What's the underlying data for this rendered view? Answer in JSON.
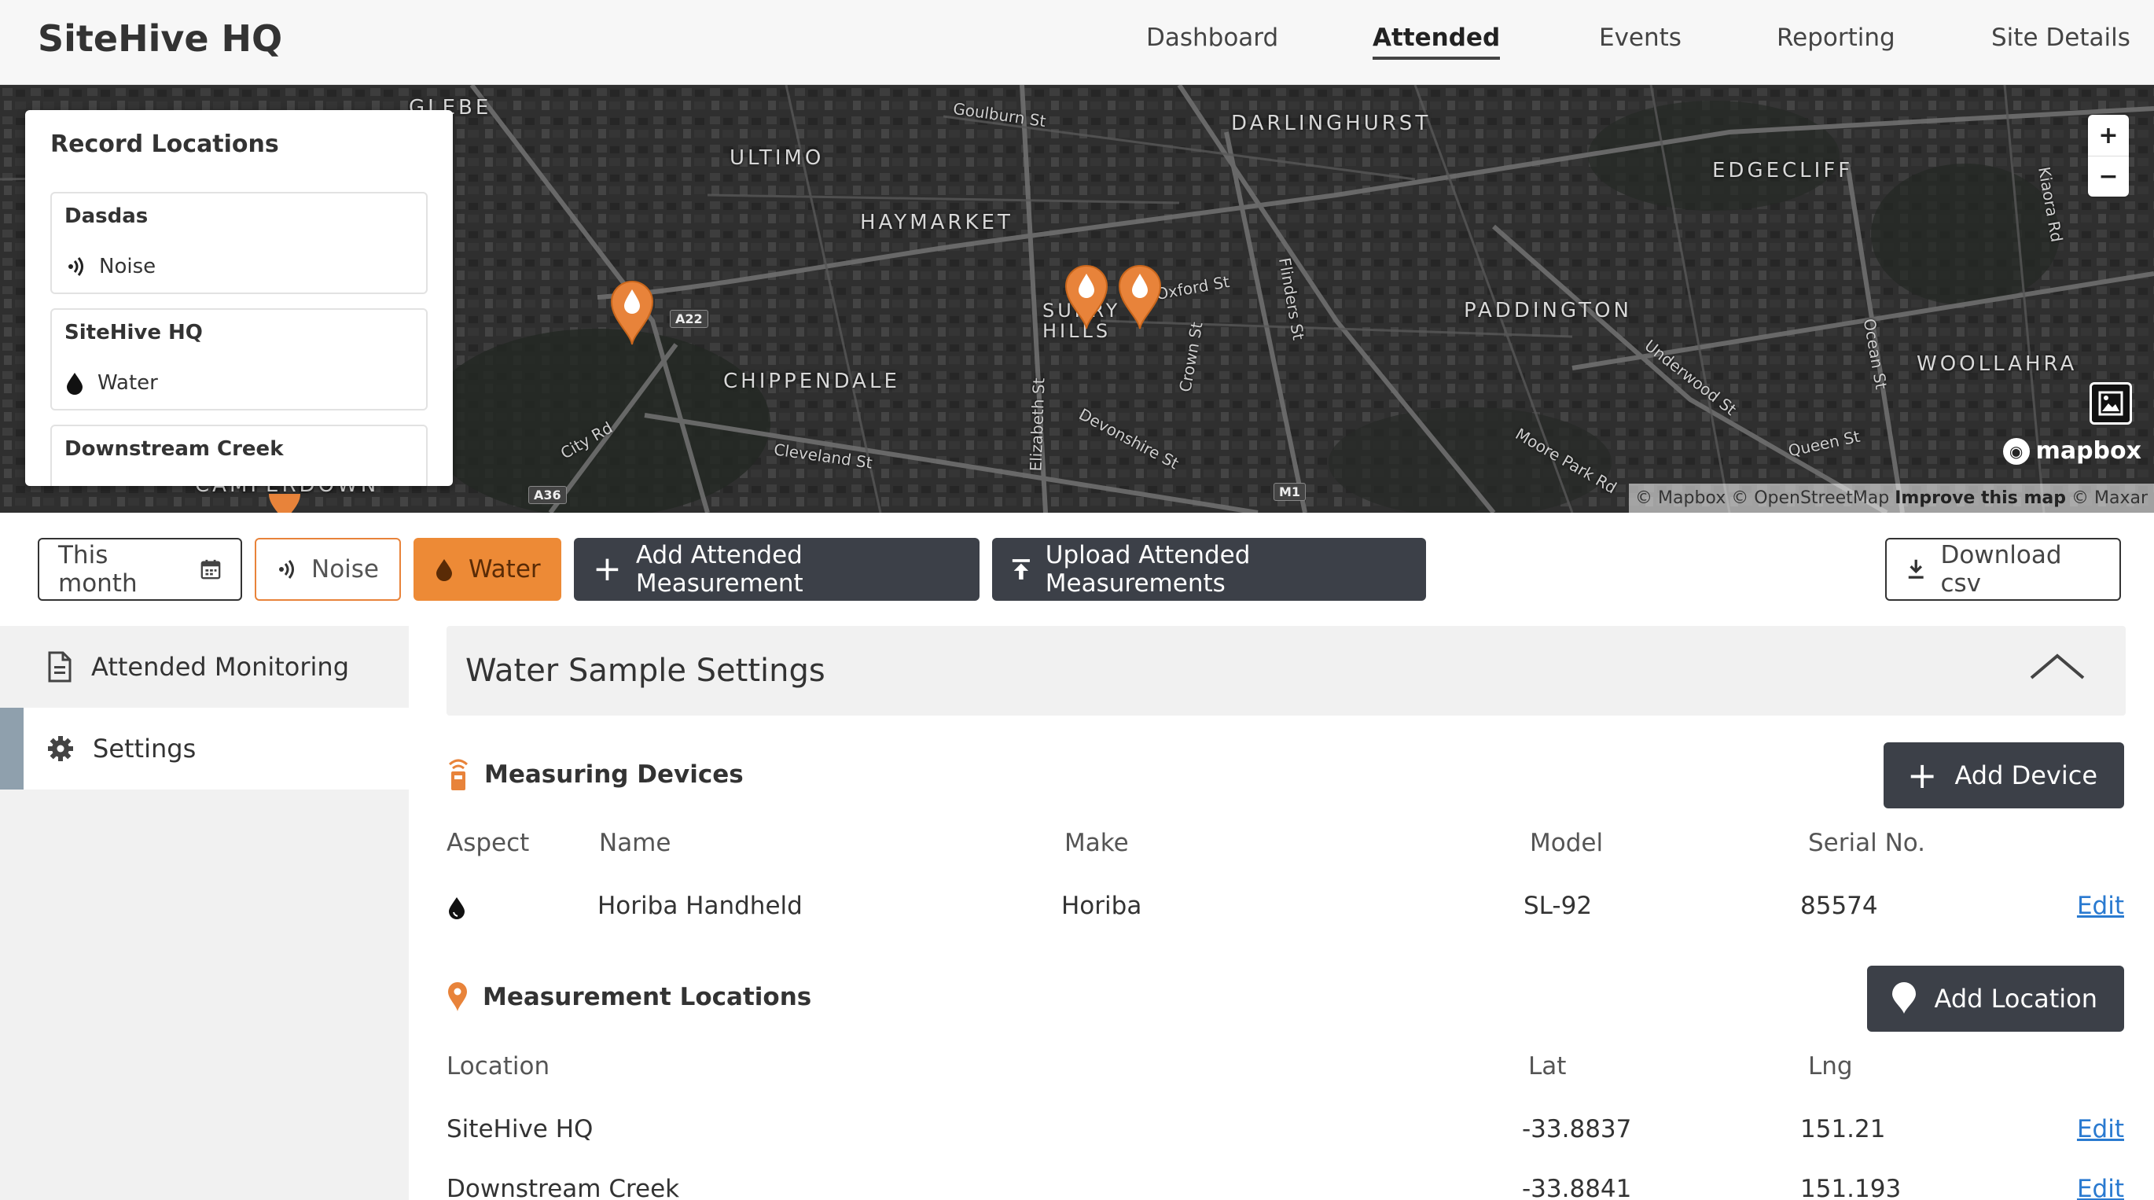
{
  "header": {
    "brand": "SiteHive HQ",
    "nav": [
      "Dashboard",
      "Attended",
      "Events",
      "Reporting",
      "Site Details"
    ],
    "active_nav": "Attended"
  },
  "map": {
    "places": [
      "GLEBE",
      "ULTIMO",
      "HAYMARKET",
      "DARLINGHURST",
      "EDGECLIFF",
      "PADDINGTON",
      "CHIPPENDALE",
      "WOOLLAHRA",
      "SURRY HILLS",
      "CAMPERDOWN"
    ],
    "streets": [
      "Goulburn St",
      "City Rd",
      "Cleveland St",
      "Devonshire St",
      "Crown St",
      "Flinders St",
      "Underwood St",
      "Ocean St",
      "Queen St",
      "Moore Park Rd",
      "Oxford St",
      "Kiaora Rd",
      "Elizabeth St"
    ],
    "road_tags": [
      "A22",
      "A36",
      "M1"
    ],
    "zoom_in": "+",
    "zoom_out": "−",
    "logo": "mapbox",
    "attribution_prefix": "© Mapbox © OpenStreetMap",
    "attribution_link": "Improve this map",
    "attribution_suffix": "© Maxar",
    "marker_color": "#e8833a"
  },
  "record_panel": {
    "title": "Record Locations",
    "items": [
      {
        "name": "Dasdas",
        "aspect": "Noise"
      },
      {
        "name": "SiteHive HQ",
        "aspect": "Water"
      },
      {
        "name": "Downstream Creek",
        "aspect": ""
      }
    ]
  },
  "toolbar": {
    "date_filter": "This month",
    "noise": "Noise",
    "water": "Water",
    "add_measurement": "Add Attended Measurement",
    "upload": "Upload Attended Measurements",
    "download": "Download csv"
  },
  "sidebar": {
    "items": [
      "Attended Monitoring",
      "Settings"
    ]
  },
  "settings": {
    "title": "Water Sample Settings",
    "devices": {
      "heading": "Measuring Devices",
      "add_label": "Add Device",
      "columns": [
        "Aspect",
        "Name",
        "Make",
        "Model",
        "Serial No."
      ],
      "rows": [
        {
          "aspect_icon": "water-drop-icon",
          "name": "Horiba Handheld",
          "make": "Horiba",
          "model": "SL-92",
          "serial": "85574",
          "action": "Edit"
        }
      ]
    },
    "locations": {
      "heading": "Measurement Locations",
      "add_label": "Add Location",
      "columns": [
        "Location",
        "Lat",
        "Lng"
      ],
      "rows": [
        {
          "location": "SiteHive HQ",
          "lat": "-33.8837",
          "lng": "151.21",
          "action": "Edit"
        },
        {
          "location": "Downstream Creek",
          "lat": "-33.8841",
          "lng": "151.193",
          "action": "Edit"
        }
      ]
    }
  },
  "colors": {
    "accent": "#ed8a36",
    "dark_button": "#3c4048",
    "link": "#2a7ad0"
  }
}
